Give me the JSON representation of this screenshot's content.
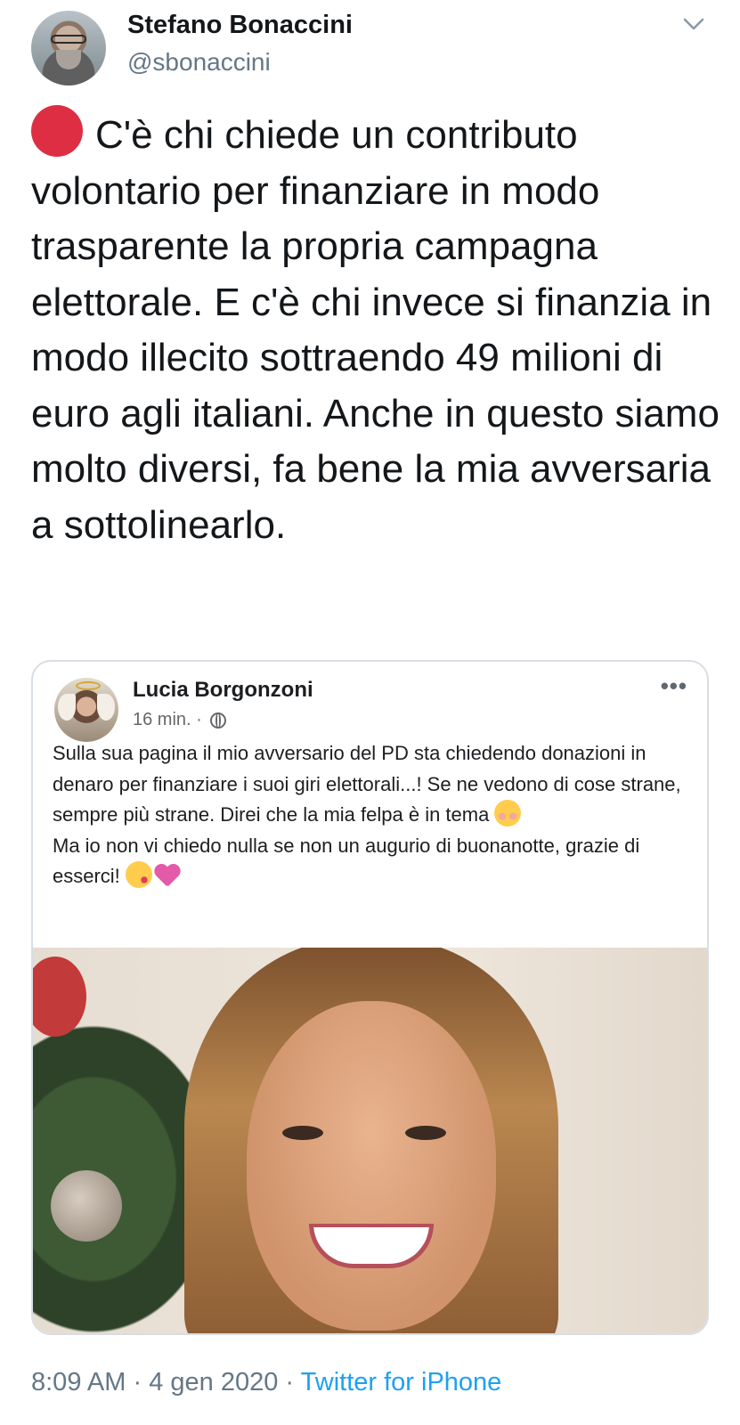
{
  "tweet": {
    "author_name": "Stefano Bonaccini",
    "author_handle": "@sbonaccini",
    "text": "C'è chi chiede un contributo volontario per finanziare in modo trasparente la propria campagna elettorale. E c'è chi invece si finanzia in modo illecito sottraendo 49 milioni di euro agli italiani. Anche in questo siamo molto diversi, fa bene la mia avversaria a sottolinearlo.",
    "time": "8:09 AM",
    "date": "4 gen 2020",
    "separator": "·",
    "source": "Twitter for iPhone",
    "leading_emoji": "red-circle-icon"
  },
  "embedded_post": {
    "author_name": "Lucia Borgonzoni",
    "meta_time": "16 min. ·",
    "more_label": "•••",
    "text_part1": "Sulla sua pagina il mio avversario del PD sta chiedendo donazioni in denaro per finanziare i suoi giri elettorali...! Se ne vedono di cose strane, sempre più strane. Direi che la mia felpa è in tema ",
    "text_line2": "Ma io non vi chiedo nulla se non un augurio di buonanotte, grazie di esserci! ",
    "emojis": [
      "smiling-blush-icon",
      "kiss-face-icon",
      "heart-icon"
    ]
  },
  "colors": {
    "text": "#14171a",
    "muted": "#657786",
    "link": "#1da1f2",
    "red_dot": "#dd2e44"
  }
}
